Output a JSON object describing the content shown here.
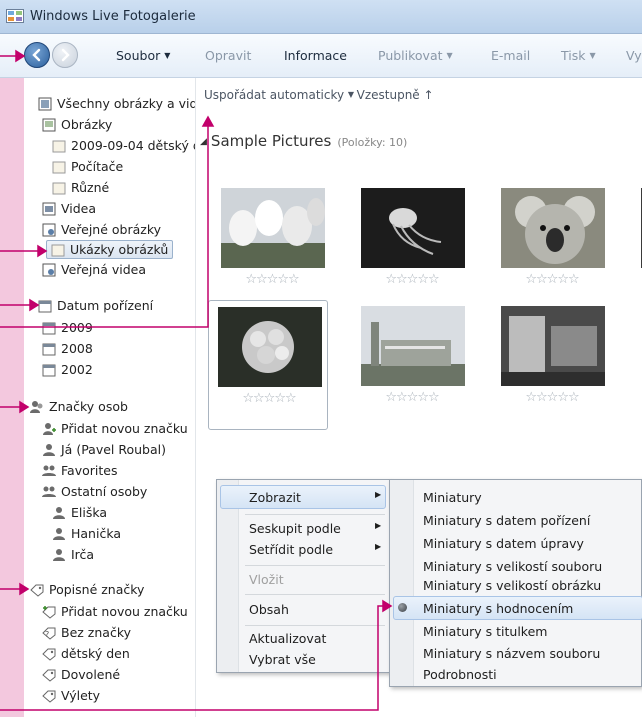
{
  "window": {
    "title": "Windows Live Fotogalerie"
  },
  "toolbar": {
    "items": [
      {
        "label": "Soubor",
        "dropdown": true
      },
      {
        "label": "Opravit",
        "dropdown": false
      },
      {
        "label": "Informace",
        "dropdown": false
      },
      {
        "label": "Publikovat",
        "dropdown": true
      },
      {
        "label": "E-mail",
        "dropdown": false
      },
      {
        "label": "Tisk",
        "dropdown": true
      },
      {
        "label": "Vy",
        "dropdown": false
      }
    ]
  },
  "nav": {
    "items": [
      {
        "label": "Všechny obrázky a vid",
        "icon": "all-media-icon"
      },
      {
        "label": "Obrázky",
        "icon": "pictures-folder-icon"
      },
      {
        "label": "2009-09-04 dětský d",
        "icon": "folder-icon"
      },
      {
        "label": "Počítače",
        "icon": "folder-icon"
      },
      {
        "label": "Různé",
        "icon": "folder-icon"
      },
      {
        "label": "Videa",
        "icon": "videos-folder-icon"
      },
      {
        "label": "Veřejné obrázky",
        "icon": "public-pictures-icon"
      },
      {
        "label": "Ukázky obrázků",
        "icon": "folder-icon",
        "selected": true
      },
      {
        "label": "Veřejná videa",
        "icon": "public-videos-icon"
      },
      {
        "label": "Datum pořízení",
        "icon": "calendar-icon"
      },
      {
        "label": "2009",
        "icon": "calendar-icon"
      },
      {
        "label": "2008",
        "icon": "calendar-icon"
      },
      {
        "label": "2002",
        "icon": "calendar-icon"
      },
      {
        "label": "Značky osob",
        "icon": "people-icon"
      },
      {
        "label": "Přidat novou značku",
        "icon": "add-person-icon"
      },
      {
        "label": "Já (Pavel Roubal)",
        "icon": "person-icon"
      },
      {
        "label": "Favorites",
        "icon": "people-group-icon"
      },
      {
        "label": "Ostatní osoby",
        "icon": "people-group-icon"
      },
      {
        "label": "Eliška",
        "icon": "person-icon"
      },
      {
        "label": "Hanička",
        "icon": "person-icon"
      },
      {
        "label": "Irča",
        "icon": "person-icon"
      },
      {
        "label": "Popisné značky",
        "icon": "tag-icon"
      },
      {
        "label": "Přidat novou značku",
        "icon": "add-tag-icon"
      },
      {
        "label": "Bez značky",
        "icon": "no-tag-icon"
      },
      {
        "label": "dětský den",
        "icon": "tag-icon"
      },
      {
        "label": "Dovolené",
        "icon": "tag-icon"
      },
      {
        "label": "Výlety",
        "icon": "tag-icon"
      }
    ]
  },
  "main": {
    "sort_label": "Uspořádat automaticky",
    "order_label": "Vzestupně",
    "group_title": "Sample Pictures",
    "group_count": "(Položky: 10)",
    "thumbnails": [
      {
        "subject": "tulips",
        "rating": 0
      },
      {
        "subject": "jellyfish",
        "rating": 0
      },
      {
        "subject": "koala",
        "rating": 0
      },
      {
        "subject": "hydrangeas",
        "rating": 0
      },
      {
        "subject": "buildings",
        "rating": 0
      },
      {
        "subject": "room",
        "rating": 0
      }
    ],
    "star_glyphs": "☆☆☆☆☆"
  },
  "context_menu": {
    "items": [
      {
        "label": "Zobrazit",
        "submenu": true,
        "highlighted": true
      },
      {
        "label": "Seskupit podle",
        "submenu": true
      },
      {
        "label": "Setřídit podle",
        "submenu": true
      },
      {
        "label": "Vložit",
        "disabled": true
      },
      {
        "label": "Obsah"
      },
      {
        "label": "Aktualizovat"
      },
      {
        "label": "Vybrat vše"
      }
    ]
  },
  "view_submenu": {
    "items": [
      {
        "label": "Miniatury"
      },
      {
        "label": "Miniatury s datem pořízení"
      },
      {
        "label": "Miniatury s datem úpravy"
      },
      {
        "label": "Miniatury s velikostí souboru"
      },
      {
        "label": "Miniatury s velikostí obrázku"
      },
      {
        "label": "Miniatury s hodnocením",
        "checked": true
      },
      {
        "label": "Miniatury s titulkem"
      },
      {
        "label": "Miniatury s názvem souboru"
      },
      {
        "label": "Podrobnosti"
      }
    ]
  },
  "colors": {
    "annotation": "#c2006b",
    "background": "#f3c8de",
    "selection": "#d5e4f5"
  }
}
